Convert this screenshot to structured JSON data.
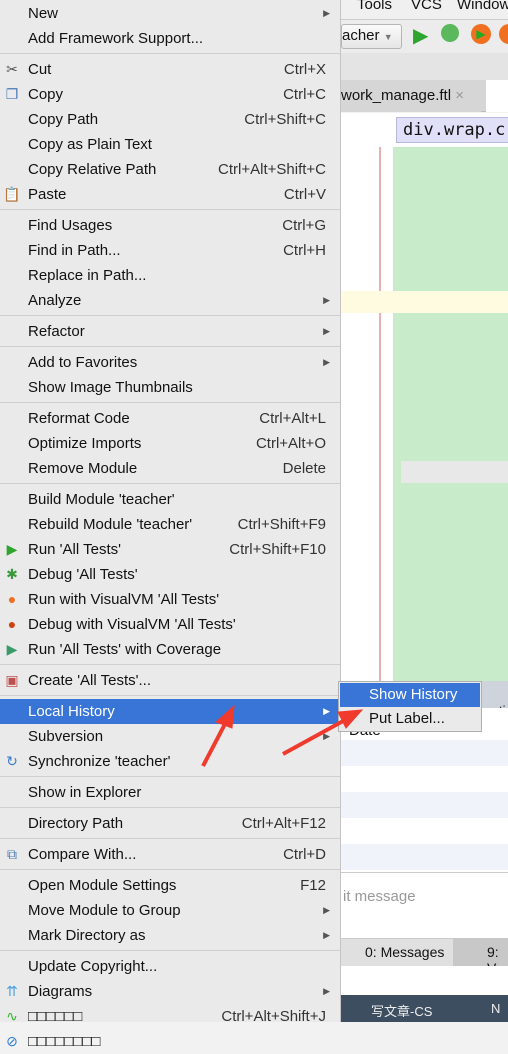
{
  "ide": {
    "menubar": [
      "Tools",
      "VCS",
      "Window"
    ],
    "run_config": "acher",
    "tab": "work_manage.ftl",
    "breadcrumb": "div.wrap.c",
    "bottom_panel": {
      "column_header": "Date",
      "tab_fragment": "matio",
      "commit_placeholder": "it message"
    },
    "tool_tabs": [
      "0: Messages",
      "9: V"
    ],
    "taskbar": [
      "写文章-CS",
      "N"
    ]
  },
  "menu": [
    {
      "label": "New",
      "submenu": true
    },
    {
      "label": "Add Framework Support..."
    },
    {
      "sep": true
    },
    {
      "label": "Cut",
      "shortcut": "Ctrl+X",
      "icon": "scissors-icon"
    },
    {
      "label": "Copy",
      "shortcut": "Ctrl+C",
      "icon": "copy-icon"
    },
    {
      "label": "Copy Path",
      "shortcut": "Ctrl+Shift+C"
    },
    {
      "label": "Copy as Plain Text"
    },
    {
      "label": "Copy Relative Path",
      "shortcut": "Ctrl+Alt+Shift+C"
    },
    {
      "label": "Paste",
      "shortcut": "Ctrl+V",
      "icon": "paste-icon"
    },
    {
      "sep": true
    },
    {
      "label": "Find Usages",
      "shortcut": "Ctrl+G"
    },
    {
      "label": "Find in Path...",
      "shortcut": "Ctrl+H"
    },
    {
      "label": "Replace in Path..."
    },
    {
      "label": "Analyze",
      "submenu": true
    },
    {
      "sep": true
    },
    {
      "label": "Refactor",
      "submenu": true
    },
    {
      "sep": true
    },
    {
      "label": "Add to Favorites",
      "submenu": true
    },
    {
      "label": "Show Image Thumbnails"
    },
    {
      "sep": true
    },
    {
      "label": "Reformat Code",
      "shortcut": "Ctrl+Alt+L"
    },
    {
      "label": "Optimize Imports",
      "shortcut": "Ctrl+Alt+O"
    },
    {
      "label": "Remove Module",
      "shortcut": "Delete"
    },
    {
      "sep": true
    },
    {
      "label": "Build Module 'teacher'"
    },
    {
      "label": "Rebuild Module 'teacher'",
      "shortcut": "Ctrl+Shift+F9"
    },
    {
      "label": "Run 'All Tests'",
      "shortcut": "Ctrl+Shift+F10",
      "icon": "run-icon"
    },
    {
      "label": "Debug 'All Tests'",
      "icon": "debug-icon"
    },
    {
      "label": "Run with VisualVM 'All Tests'",
      "icon": "visualvm-run-icon"
    },
    {
      "label": "Debug with VisualVM 'All Tests'",
      "icon": "visualvm-debug-icon"
    },
    {
      "label": "Run 'All Tests' with Coverage",
      "icon": "coverage-icon"
    },
    {
      "sep": true
    },
    {
      "label": "Create 'All Tests'...",
      "icon": "create-test-icon"
    },
    {
      "sep": true
    },
    {
      "label": "Local History",
      "submenu": true,
      "highlighted": true
    },
    {
      "label": "Subversion",
      "submenu": true
    },
    {
      "label": "Synchronize 'teacher'",
      "icon": "sync-icon"
    },
    {
      "sep": true
    },
    {
      "label": "Show in Explorer"
    },
    {
      "sep": true
    },
    {
      "label": "Directory Path",
      "shortcut": "Ctrl+Alt+F12"
    },
    {
      "sep": true
    },
    {
      "label": "Compare With...",
      "shortcut": "Ctrl+D",
      "icon": "compare-icon"
    },
    {
      "sep": true
    },
    {
      "label": "Open Module Settings",
      "shortcut": "F12"
    },
    {
      "label": "Move Module to Group",
      "submenu": true
    },
    {
      "label": "Mark Directory as",
      "submenu": true
    },
    {
      "sep": true
    },
    {
      "label": "Update Copyright..."
    },
    {
      "label": "Diagrams",
      "submenu": true,
      "icon": "diagrams-icon"
    },
    {
      "label": "□□□□□□",
      "shortcut": "Ctrl+Alt+Shift+J",
      "icon": "activity-icon"
    },
    {
      "label": "□□□□□□□□",
      "icon": "no-entry-icon"
    }
  ],
  "submenu": [
    {
      "label": "Show History",
      "highlighted": true
    },
    {
      "label": "Put Label..."
    }
  ],
  "colors": {
    "highlight": "#3875d7",
    "menu_bg": "#eaeaea",
    "annotation_arrow": "#f03a2e"
  }
}
